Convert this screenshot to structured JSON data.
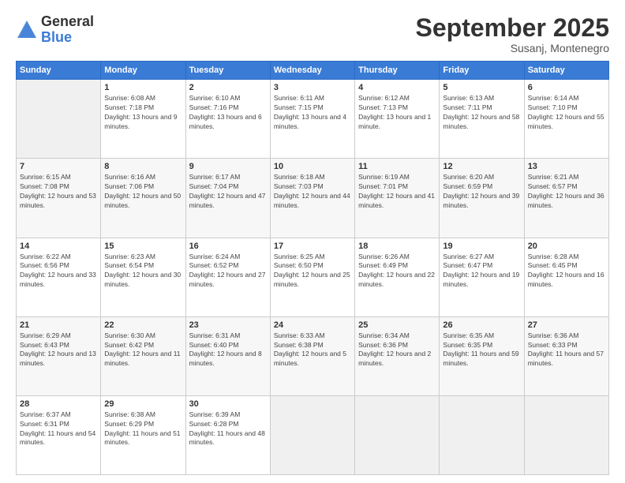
{
  "logo": {
    "general": "General",
    "blue": "Blue"
  },
  "title": {
    "main": "September 2025",
    "sub": "Susanj, Montenegro"
  },
  "days_of_week": [
    "Sunday",
    "Monday",
    "Tuesday",
    "Wednesday",
    "Thursday",
    "Friday",
    "Saturday"
  ],
  "weeks": [
    [
      null,
      {
        "day": 1,
        "sunrise": "6:08 AM",
        "sunset": "7:18 PM",
        "daylight": "13 hours and 9 minutes."
      },
      {
        "day": 2,
        "sunrise": "6:10 AM",
        "sunset": "7:16 PM",
        "daylight": "13 hours and 6 minutes."
      },
      {
        "day": 3,
        "sunrise": "6:11 AM",
        "sunset": "7:15 PM",
        "daylight": "13 hours and 4 minutes."
      },
      {
        "day": 4,
        "sunrise": "6:12 AM",
        "sunset": "7:13 PM",
        "daylight": "13 hours and 1 minute."
      },
      {
        "day": 5,
        "sunrise": "6:13 AM",
        "sunset": "7:11 PM",
        "daylight": "12 hours and 58 minutes."
      },
      {
        "day": 6,
        "sunrise": "6:14 AM",
        "sunset": "7:10 PM",
        "daylight": "12 hours and 55 minutes."
      }
    ],
    [
      {
        "day": 7,
        "sunrise": "6:15 AM",
        "sunset": "7:08 PM",
        "daylight": "12 hours and 53 minutes."
      },
      {
        "day": 8,
        "sunrise": "6:16 AM",
        "sunset": "7:06 PM",
        "daylight": "12 hours and 50 minutes."
      },
      {
        "day": 9,
        "sunrise": "6:17 AM",
        "sunset": "7:04 PM",
        "daylight": "12 hours and 47 minutes."
      },
      {
        "day": 10,
        "sunrise": "6:18 AM",
        "sunset": "7:03 PM",
        "daylight": "12 hours and 44 minutes."
      },
      {
        "day": 11,
        "sunrise": "6:19 AM",
        "sunset": "7:01 PM",
        "daylight": "12 hours and 41 minutes."
      },
      {
        "day": 12,
        "sunrise": "6:20 AM",
        "sunset": "6:59 PM",
        "daylight": "12 hours and 39 minutes."
      },
      {
        "day": 13,
        "sunrise": "6:21 AM",
        "sunset": "6:57 PM",
        "daylight": "12 hours and 36 minutes."
      }
    ],
    [
      {
        "day": 14,
        "sunrise": "6:22 AM",
        "sunset": "6:56 PM",
        "daylight": "12 hours and 33 minutes."
      },
      {
        "day": 15,
        "sunrise": "6:23 AM",
        "sunset": "6:54 PM",
        "daylight": "12 hours and 30 minutes."
      },
      {
        "day": 16,
        "sunrise": "6:24 AM",
        "sunset": "6:52 PM",
        "daylight": "12 hours and 27 minutes."
      },
      {
        "day": 17,
        "sunrise": "6:25 AM",
        "sunset": "6:50 PM",
        "daylight": "12 hours and 25 minutes."
      },
      {
        "day": 18,
        "sunrise": "6:26 AM",
        "sunset": "6:49 PM",
        "daylight": "12 hours and 22 minutes."
      },
      {
        "day": 19,
        "sunrise": "6:27 AM",
        "sunset": "6:47 PM",
        "daylight": "12 hours and 19 minutes."
      },
      {
        "day": 20,
        "sunrise": "6:28 AM",
        "sunset": "6:45 PM",
        "daylight": "12 hours and 16 minutes."
      }
    ],
    [
      {
        "day": 21,
        "sunrise": "6:29 AM",
        "sunset": "6:43 PM",
        "daylight": "12 hours and 13 minutes."
      },
      {
        "day": 22,
        "sunrise": "6:30 AM",
        "sunset": "6:42 PM",
        "daylight": "12 hours and 11 minutes."
      },
      {
        "day": 23,
        "sunrise": "6:31 AM",
        "sunset": "6:40 PM",
        "daylight": "12 hours and 8 minutes."
      },
      {
        "day": 24,
        "sunrise": "6:33 AM",
        "sunset": "6:38 PM",
        "daylight": "12 hours and 5 minutes."
      },
      {
        "day": 25,
        "sunrise": "6:34 AM",
        "sunset": "6:36 PM",
        "daylight": "12 hours and 2 minutes."
      },
      {
        "day": 26,
        "sunrise": "6:35 AM",
        "sunset": "6:35 PM",
        "daylight": "11 hours and 59 minutes."
      },
      {
        "day": 27,
        "sunrise": "6:36 AM",
        "sunset": "6:33 PM",
        "daylight": "11 hours and 57 minutes."
      }
    ],
    [
      {
        "day": 28,
        "sunrise": "6:37 AM",
        "sunset": "6:31 PM",
        "daylight": "11 hours and 54 minutes."
      },
      {
        "day": 29,
        "sunrise": "6:38 AM",
        "sunset": "6:29 PM",
        "daylight": "11 hours and 51 minutes."
      },
      {
        "day": 30,
        "sunrise": "6:39 AM",
        "sunset": "6:28 PM",
        "daylight": "11 hours and 48 minutes."
      },
      null,
      null,
      null,
      null
    ]
  ],
  "labels": {
    "sunrise": "Sunrise:",
    "sunset": "Sunset:",
    "daylight": "Daylight:"
  }
}
